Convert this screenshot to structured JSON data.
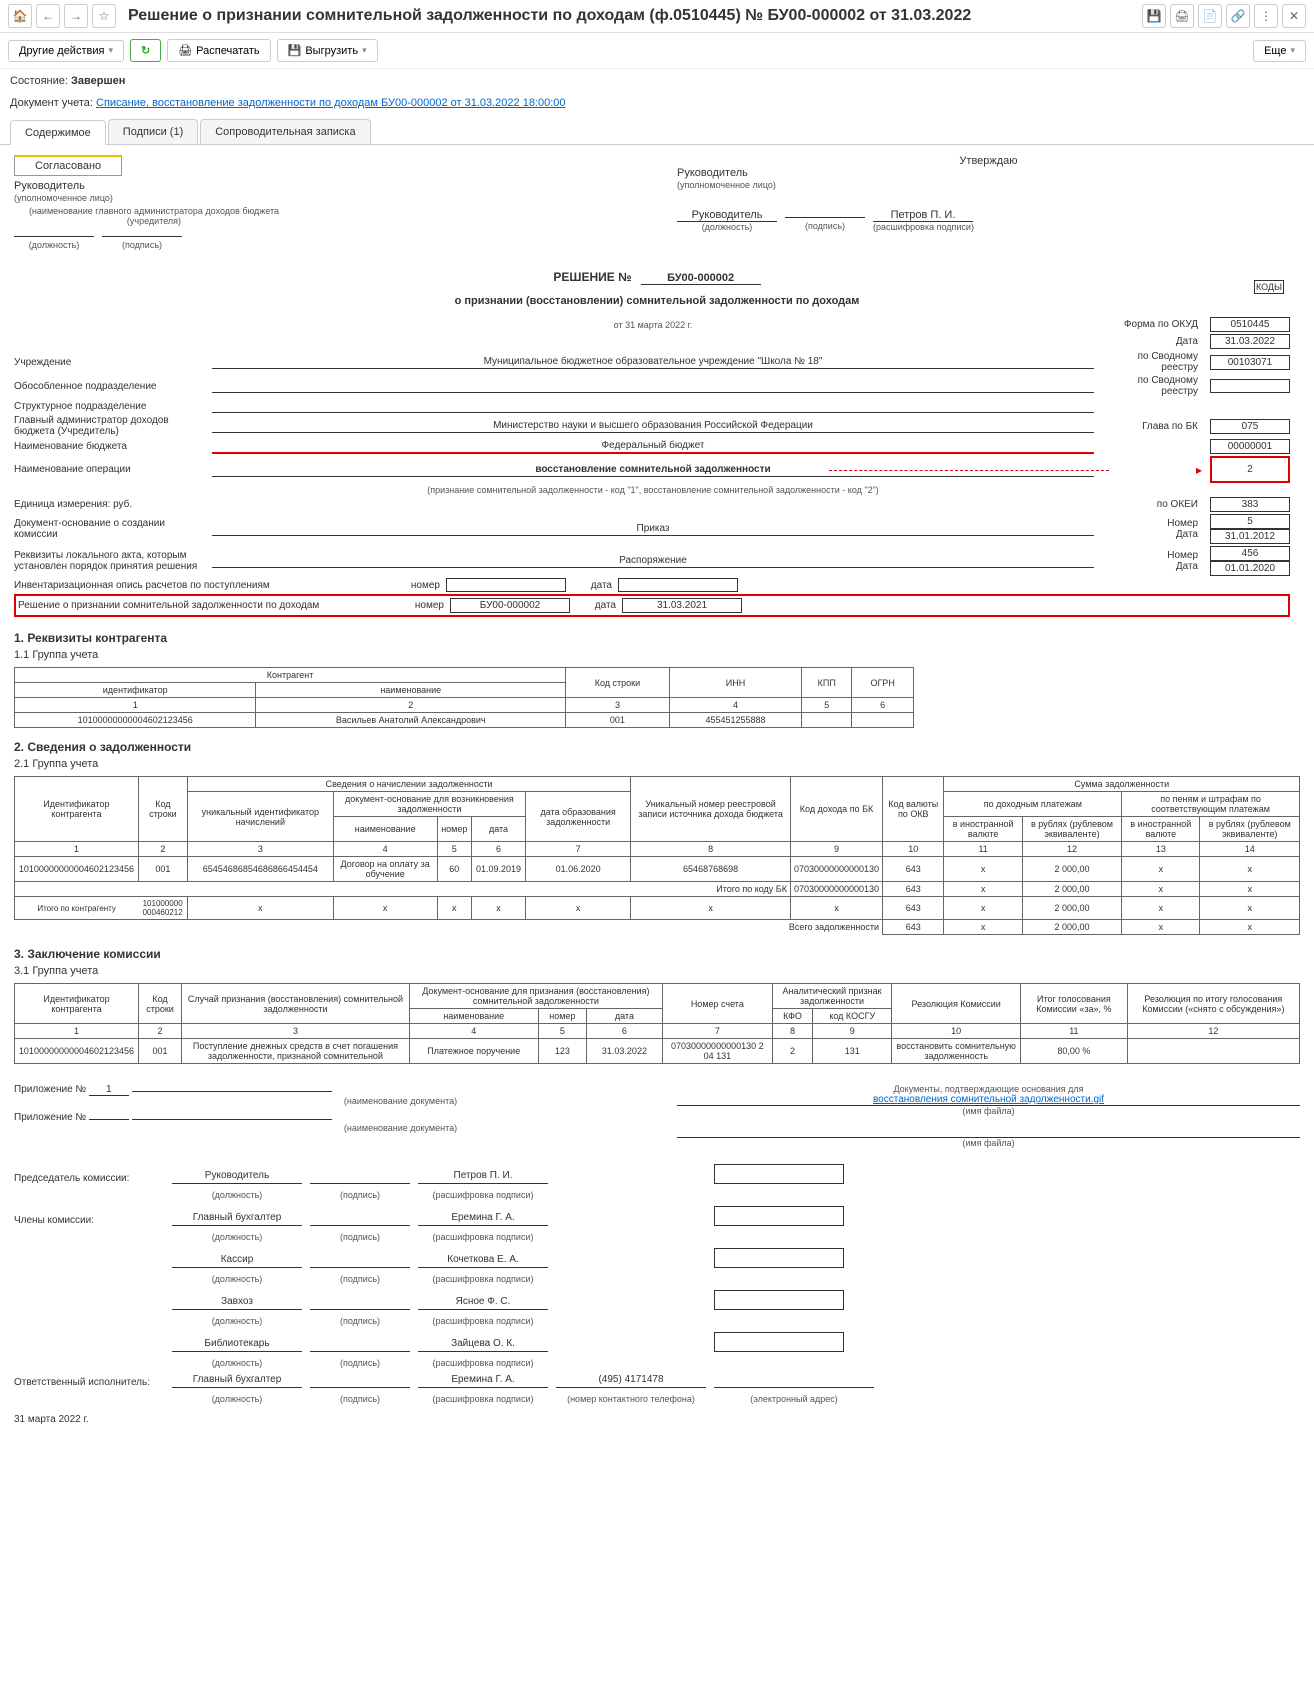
{
  "title": "Решение о признании сомнительной задолженности по доходам (ф.0510445) № БУ00-000002 от 31.03.2022",
  "toolbar": {
    "other_actions": "Другие действия",
    "print": "Распечатать",
    "export": "Выгрузить",
    "more": "Еще"
  },
  "status": {
    "label": "Состояние:",
    "value": "Завершен"
  },
  "doc": {
    "label": "Документ учета:",
    "link": "Списание, восстановление задолженности по доходам БУ00-000002 от 31.03.2022 18:00:00"
  },
  "tabs": {
    "t1": "Содержимое",
    "t2": "Подписи (1)",
    "t3": "Сопроводительная записка"
  },
  "approval": {
    "agreed": "Согласовано",
    "approved": "Утверждаю",
    "head": "Руководитель",
    "head_note": "(уполномоченное лицо)",
    "admin_note": "(наименование главного администратора доходов бюджета (учредителя)",
    "position": "(должность)",
    "signature": "(подпись)",
    "decode": "(расшифровка подписи)",
    "petrov": "Петров П. И."
  },
  "header": {
    "decision": "РЕШЕНИЕ №",
    "number": "БУ00-000002",
    "subtitle": "о признании (восстановлении) сомнительной задолженности по доходам",
    "date_line": "от 31 марта 2022 г."
  },
  "codes_header": "КОДЫ",
  "form": {
    "okud_l": "Форма по ОКУД",
    "okud": "0510445",
    "date_l": "Дата",
    "date": "31.03.2022",
    "org_l": "Учреждение",
    "org": "Муниципальное бюджетное образовательное учреждение \"Школа № 18\"",
    "svod_l": "по Сводному реестру",
    "svod": "00103071",
    "obos_l": "Обособленное подразделение",
    "svod2_l": "по Сводному реестру",
    "struct_l": "Структурное подразделение",
    "admin_l": "Главный администратор доходов бюджета (Учредитель)",
    "admin": "Министерство науки и высшего образования Российской Федерации",
    "bk_l": "Глава по БК",
    "bk": "075",
    "budget_l": "Наименование бюджета",
    "budget": "Федеральный бюджет",
    "budget_code": "00000001",
    "op_l": "Наименование операции",
    "op": "восстановление сомнительной задолженности",
    "op_code": "2",
    "op_note": "(признание сомнительной задолженности - код \"1\", восстановление сомнительной задолженности - код \"2\")",
    "unit_l": "Единица измерения: руб.",
    "okei_l": "по ОКЕИ",
    "okei": "383",
    "basis_l": "Документ-основание о создании комиссии",
    "basis": "Приказ",
    "num_l": "Номер",
    "basis_num": "5",
    "basis_date": "31.01.2012",
    "local_l": "Реквизиты локального акта, которым установлен порядок принятия решения",
    "local": "Распоряжение",
    "local_num": "456",
    "local_date": "01.01.2020",
    "inv_l": "Инвентаризационная опись расчетов по поступлениям",
    "dec_l": "Решение о признании сомнительной задолженности по доходам",
    "num_t": "номер",
    "date_t": "дата",
    "dec_num": "БУ00-000002",
    "dec_date": "31.03.2021"
  },
  "s1": {
    "h": "1. Реквизиты контрагента",
    "sub": "1.1 Группа учета"
  },
  "t1": {
    "h": {
      "ka": "Контрагент",
      "id": "идентификатор",
      "name": "наименование",
      "row": "Код строки",
      "inn": "ИНН",
      "kpp": "КПП",
      "ogrn": "ОГРН"
    },
    "n": {
      "c1": "1",
      "c2": "2",
      "c3": "3",
      "c4": "4",
      "c5": "5",
      "c6": "6"
    },
    "r": {
      "id": "10100000000004602123456",
      "name": "Васильев Анатолий Александрович",
      "row": "001",
      "inn": "455451255888",
      "kpp": "",
      "ogrn": ""
    }
  },
  "s2": {
    "h": "2. Сведения о задолженности",
    "sub": "2.1 Группа учета"
  },
  "t2": {
    "h": {
      "accr": "Сведения о начислении задолженности",
      "id": "Идентификатор контрагента",
      "row": "Код строки",
      "uid": "уникальный идентификатор начислений",
      "basis": "документ-основание для возникновения задолженности",
      "name": "наименование",
      "num": "номер",
      "date": "дата",
      "formed": "дата образования задолженности",
      "unr": "Уникальный номер реестровой записи источника дохода бюджета",
      "bk": "Код дохода по БК",
      "okv": "Код валюты по ОКВ",
      "sum": "Сумма задолженности",
      "inc": "по доходным платежам",
      "pen": "по пеням и штрафам по соответствующим платежам",
      "fc": "в иностранной валюте",
      "rub": "в рублях (рублевом эквиваленте)"
    },
    "n": [
      "1",
      "2",
      "3",
      "4",
      "5",
      "6",
      "7",
      "8",
      "9",
      "10",
      "11",
      "12",
      "13",
      "14"
    ],
    "r": {
      "id": "10100000000004602123456",
      "row": "001",
      "uid": "65454686854686866454454",
      "name": "Договор на оплату за обучение",
      "num": "60",
      "date": "01.09.2019",
      "formed": "01.06.2020",
      "unr": "65468768698",
      "bk": "07030000000000130",
      "okv": "643",
      "c11": "x",
      "c12": "2 000,00",
      "c13": "x",
      "c14": "x"
    },
    "tot_bk": "Итого по коду БК",
    "tot_ka": "Итого по контрагенту",
    "tot_all": "Всего задолженности",
    "ka_id1": "101000000",
    "ka_id2": "000460212"
  },
  "s3": {
    "h": "3. Заключение комиссии",
    "sub": "3.1 Группа учета"
  },
  "t3": {
    "h": {
      "id": "Идентификатор контрагента",
      "row": "Код строки",
      "case": "Случай признания (восстановления) сомнительной задолженности",
      "basis": "Документ-основание для признания (восстановления) сомнительной задолженности",
      "name": "наименование",
      "num": "номер",
      "date": "дата",
      "acct": "Номер счета",
      "anal": "Аналитический признак задолженности",
      "kfo": "КФО",
      "kosgu": "код КОСГУ",
      "res": "Резолюция Комиссии",
      "vote": "Итог голосования Комиссии «за», %",
      "res2": "Резолюция по итогу голосования Комиссии («снято с обсуждения»)"
    },
    "n": [
      "1",
      "2",
      "3",
      "4",
      "5",
      "6",
      "7",
      "8",
      "9",
      "10",
      "11",
      "12"
    ],
    "r": {
      "id": "10100000000004602123456",
      "row": "001",
      "case": "Поступление днежных средств в счет погашения задолженности, признаной сомнительной",
      "name": "Платежное поручение",
      "num": "123",
      "date": "31.03.2022",
      "acct": "07030000000000130 2 04 131",
      "kfo": "2",
      "kosgu": "131",
      "res": "восстановить сомнительную задолженность",
      "vote": "80,00 %",
      "res2": ""
    }
  },
  "att": {
    "l": "Приложение №",
    "n1": "1",
    "doc_name": "(наименование документа)",
    "conf": "Документы, подтверждающие основания для",
    "file": "восстановления сомнительной задолженности.gif",
    "file_l": "(имя файла)"
  },
  "sig": {
    "chair_l": "Председатель комиссии:",
    "members_l": "Члены комиссии:",
    "exec_l": "Ответственный исполнитель:",
    "pos": "(должность)",
    "sign": "(подпись)",
    "decode": "(расшифровка подписи)",
    "phone_l": "(номер контактного телефона)",
    "email_l": "(электронный адрес)",
    "p1": "Руководитель",
    "n1": "Петров П. И.",
    "p2": "Главный бухгалтер",
    "n2": "Еремина Г. А.",
    "p3": "Кассир",
    "n3": "Кочеткова Е. А.",
    "p4": "Завхоз",
    "n4": "Ясное Ф. С.",
    "p5": "Библиотекарь",
    "n5": "Зайцева О. К.",
    "p6": "Главный бухгалтер",
    "n6": "Еремина Г. А.",
    "phone": "(495) 4171478"
  },
  "footer_date": "31 марта 2022 г."
}
